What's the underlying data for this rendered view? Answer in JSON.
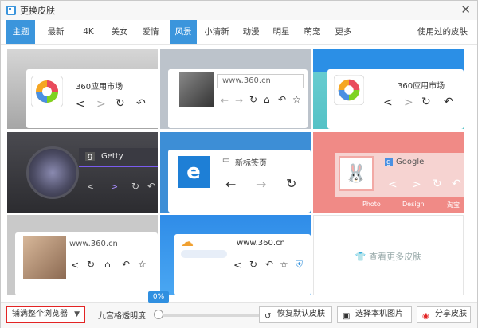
{
  "window": {
    "title": "更换皮肤",
    "close_glyph": "✕"
  },
  "tabs": [
    {
      "label": "主题",
      "active": true
    },
    {
      "label": "最新"
    },
    {
      "label": "4K"
    },
    {
      "label": "美女"
    },
    {
      "label": "爱情"
    },
    {
      "label": "风景"
    },
    {
      "label": "小清新"
    },
    {
      "label": "动漫"
    },
    {
      "label": "明星"
    },
    {
      "label": "萌宠"
    },
    {
      "label": "更多"
    }
  ],
  "used_skins_label": "使用过的皮肤",
  "skins": {
    "t1": {
      "label": "360应用市场"
    },
    "t2": {
      "label": "www.360.cn"
    },
    "t3": {
      "label": "360应用市场"
    },
    "t4": {
      "label": "Getty"
    },
    "t5": {
      "label": "新标签页"
    },
    "t6": {
      "label": "Google",
      "bm1": "Photo",
      "bm2": "Design",
      "bm3": "淘宝"
    },
    "t7": {
      "label": "www.360.cn"
    },
    "t8": {
      "label": "www.360.cn"
    }
  },
  "more_skins_label": "查看更多皮肤",
  "bottom": {
    "fill_select": "铺满整个浏览器",
    "opacity_label": "九宫格透明度",
    "opacity_value": "0%",
    "opacity_fraction": 0,
    "restore_default": "恢复默认皮肤",
    "choose_local": "选择本机图片",
    "share_skin": "分享皮肤"
  },
  "colors": {
    "accent": "#3b95dc",
    "highlight_border": "#e32424"
  }
}
